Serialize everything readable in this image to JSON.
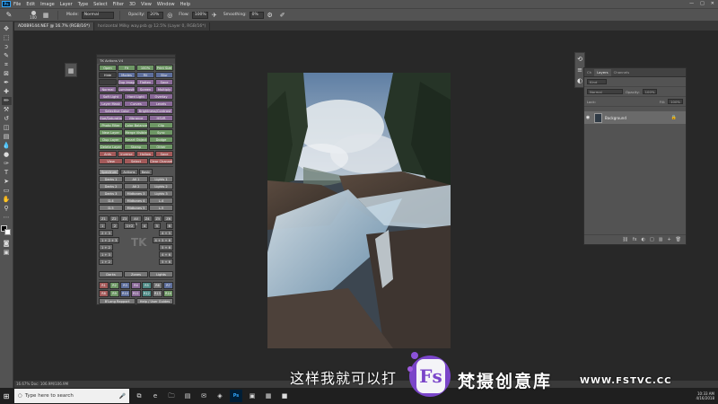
{
  "menubar": {
    "logo": "Ps",
    "items": [
      "File",
      "Edit",
      "Image",
      "Layer",
      "Type",
      "Select",
      "Filter",
      "3D",
      "View",
      "Window",
      "Help"
    ],
    "controls": [
      "—",
      "□",
      "✕"
    ]
  },
  "options": {
    "brush_size": "100",
    "mode_label": "Mode:",
    "mode_value": "Normal",
    "opacity_label": "Opacity:",
    "opacity_value": "20%",
    "flow_label": "Flow:",
    "flow_value": "100%",
    "smoothing_label": "Smoothing:",
    "smoothing_value": "0%"
  },
  "tabs": [
    {
      "label": "AD0B9144.NEF @ 16.7% (RGB/16*)",
      "active": true
    },
    {
      "label": "horizontal Milky way.psb @ 12.5% (Layer 0, RGB/16*)",
      "active": false
    }
  ],
  "tkpanel": {
    "title": "TK Actions V4",
    "rows": [
      [
        {
          "t": "Open",
          "c": "c-green"
        },
        {
          "t": "Fit",
          "c": "c-green"
        },
        {
          "t": "100%",
          "c": "c-green"
        },
        {
          "t": "Print Size",
          "c": "c-green"
        }
      ],
      [
        {
          "t": "Hide",
          "c": "c-dark"
        },
        {
          "t": "Modes",
          "c": "c-blue"
        },
        {
          "t": "Fill",
          "c": "c-blue"
        },
        {
          "t": "Blur",
          "c": "c-blue"
        }
      ],
      [
        {
          "t": "",
          "c": "c-dark"
        },
        {
          "t": "Dup Image",
          "c": "c-purple"
        },
        {
          "t": "Flatten",
          "c": "c-purple"
        },
        {
          "t": "Save",
          "c": "c-purple"
        }
      ],
      [
        {
          "t": "Normal",
          "c": "c-purple"
        },
        {
          "t": "Luminosity",
          "c": "c-purple"
        },
        {
          "t": "Screen",
          "c": "c-purple"
        },
        {
          "t": "Multiply",
          "c": "c-purple"
        }
      ],
      [
        {
          "t": "Soft Light",
          "c": "c-purple"
        },
        {
          "t": "Hard Light",
          "c": "c-purple"
        },
        {
          "t": "Overlay",
          "c": "c-purple"
        }
      ],
      [
        {
          "t": "Layer Mask",
          "c": "c-purple"
        },
        {
          "t": "Curves",
          "c": "c-purple"
        },
        {
          "t": "Levels",
          "c": "c-purple"
        }
      ],
      [
        {
          "t": "Selective Color",
          "c": "c-purple"
        },
        {
          "t": "Brightness/Contrast",
          "c": "c-purple"
        }
      ],
      [
        {
          "t": "Hue/Saturation",
          "c": "c-purple"
        },
        {
          "t": "Vibrance",
          "c": "c-purple"
        },
        {
          "t": "HSVR",
          "c": "c-purple"
        }
      ],
      [
        {
          "t": "Photo Filter",
          "c": "c-green"
        },
        {
          "t": "Color Balance",
          "c": "c-green"
        },
        {
          "t": "Clip",
          "c": "c-green"
        }
      ],
      [
        {
          "t": "New Layer",
          "c": "c-green"
        },
        {
          "t": "Merge Visible",
          "c": "c-green"
        },
        {
          "t": "Sync",
          "c": "c-green"
        }
      ],
      [
        {
          "t": "Dup Layer",
          "c": "c-green"
        },
        {
          "t": "Smart Object",
          "c": "c-green"
        },
        {
          "t": "Dodge",
          "c": "c-green"
        }
      ],
      [
        {
          "t": "Delete Layer",
          "c": "c-green"
        },
        {
          "t": "Stamp",
          "c": "c-green"
        },
        {
          "t": "Other",
          "c": "c-green"
        }
      ],
      [
        {
          "t": "Ants",
          "c": "c-red"
        },
        {
          "t": "Inverse",
          "c": "c-red"
        },
        {
          "t": "Hollow",
          "c": "c-red"
        },
        {
          "t": "Save",
          "c": "c-red"
        }
      ],
      [
        {
          "t": "View",
          "c": "c-red"
        },
        {
          "t": "Select",
          "c": "c-red"
        },
        {
          "t": "Clear Channels",
          "c": "c-red"
        }
      ]
    ],
    "subtabs": [
      "Spectrum",
      "Actions",
      "Basic"
    ],
    "lumrows": [
      [
        "Darks 1",
        "All 1",
        "Lights 1"
      ],
      [
        "Darks 2",
        "All 2",
        "Lights 2"
      ],
      [
        "Darks 3",
        "Midtones 3",
        "Lights 3"
      ],
      [
        "D-4",
        "Midtones 4",
        "L-4"
      ],
      [
        "D-5",
        "Midtones 5",
        "L-5"
      ]
    ],
    "zone_top": [
      "Z1",
      "Z2",
      "Z3",
      "All 3",
      "Z4",
      "Z5",
      "Z6"
    ],
    "zone_rows": [
      [
        "1",
        "2",
        "1+2",
        "",
        "4",
        "5",
        "6"
      ],
      [
        "2 + 3",
        "",
        "",
        "",
        "",
        "4 + 5"
      ],
      [
        "1 + 2 + 3",
        "",
        "",
        "",
        "4 + 5 + 6"
      ],
      [
        "1 + 2",
        "",
        "",
        "",
        "5 + 6"
      ],
      [
        "1 + 3",
        "",
        "",
        "",
        "4 + 6"
      ],
      [
        "1 + 2",
        "",
        "",
        "",
        "5 + 6"
      ]
    ],
    "zone_mid": [
      "Darks",
      "Zones",
      "Lights"
    ],
    "logo": "TK",
    "swatch_rows": [
      [
        {
          "t": "R1",
          "c": "c-red"
        },
        {
          "t": "R2",
          "c": "c-green"
        },
        {
          "t": "R3",
          "c": "c-blue"
        },
        {
          "t": "R4",
          "c": "c-purple"
        },
        {
          "t": "R5",
          "c": "c-teal"
        },
        {
          "t": "R6",
          "c": "c-gray"
        },
        {
          "t": "R7",
          "c": "c-blue"
        }
      ],
      [
        {
          "t": "R8",
          "c": "c-red"
        },
        {
          "t": "R9",
          "c": "c-green"
        },
        {
          "t": "R10",
          "c": "c-blue"
        },
        {
          "t": "R11",
          "c": "c-purple"
        },
        {
          "t": "R12",
          "c": "c-teal"
        },
        {
          "t": "R13",
          "c": "c-gray"
        },
        {
          "t": "R14",
          "c": "c-green"
        }
      ]
    ],
    "footer_left": "B'Long Rapport",
    "footer_right": "Help / User Guides"
  },
  "layers": {
    "tabs": [
      "Ch",
      "Layers",
      "Channels"
    ],
    "kind_label": "Kind",
    "mode_value": "Normal",
    "opacity_label": "Opacity:",
    "opacity_value": "100%",
    "lock_label": "Lock:",
    "fill_label": "Fill:",
    "fill_value": "100%",
    "layer_name": "Background",
    "footer_icons": [
      "fx",
      "◐",
      "□",
      "▥",
      "+",
      "🗑"
    ]
  },
  "statusbar": {
    "text": "16.67%        Doc: 106.9M/106.9M"
  },
  "taskbar": {
    "search_placeholder": "Type here to search",
    "apps": [
      "⧉",
      "e",
      "🗀",
      "▤",
      "✉",
      "◈",
      "Ps",
      "▣",
      "▦",
      "■"
    ],
    "time": "10:33 AM",
    "date": "4/16/2018"
  },
  "overlay": {
    "subtitle": "这样我就可以打",
    "brand_letter": "Fs",
    "brand_text": "梵摄创意库",
    "brand_url": "WWW.FSTVC.CC"
  },
  "colors": {
    "accent": "#31a8ff",
    "watermark_purple": "#7a45c9"
  }
}
